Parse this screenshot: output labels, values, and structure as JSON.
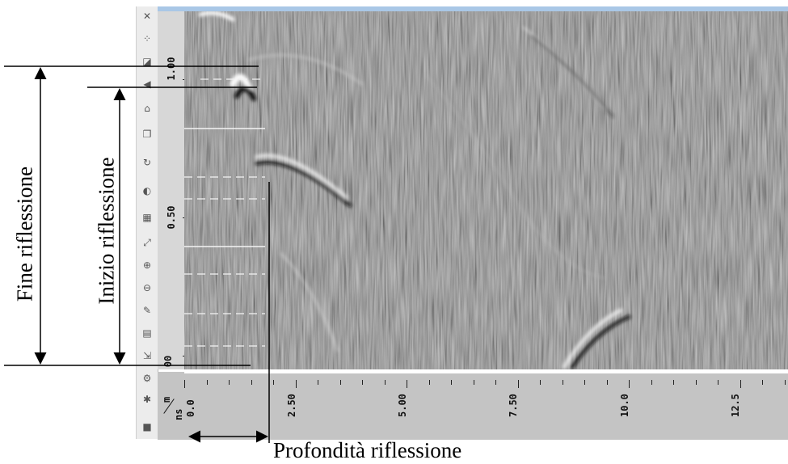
{
  "annotations": {
    "end_label": "Fine riflessione",
    "start_label": "Inizio riflessione",
    "depth_label": "Profondità riflessione"
  },
  "axis": {
    "y_ticks": [
      "1.00",
      "0.50",
      "00"
    ],
    "x_ticks": [
      "0.0",
      "2.50",
      "5.00",
      "7.50",
      "10.0",
      "12.5"
    ],
    "unit_top": "m",
    "unit_bottom": "ns"
  },
  "toolbar": {
    "icons": [
      "close-icon",
      "dots-icon",
      "flip-icon",
      "arrow-left-icon",
      "home-icon",
      "copy-icon",
      "refresh-icon",
      "circle-icon",
      "image-icon",
      "expand-icon",
      "zoom-in-icon",
      "zoom-out-icon",
      "brush-icon",
      "grid-icon",
      "cursor-icon",
      "settings-icon",
      "gear-icon",
      "page-icon"
    ]
  },
  "colors": {
    "background": "#ffffff",
    "radar_gray": "#808080",
    "toolbar": "#ececec",
    "axis": "#c4c4c4"
  }
}
